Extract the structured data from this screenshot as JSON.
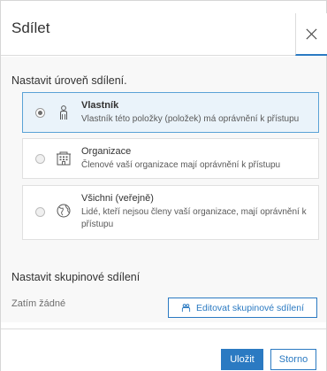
{
  "dialog": {
    "title": "Sdílet",
    "close_icon": "close-icon"
  },
  "sharing_level": {
    "heading": "Nastavit úroveň sdílení.",
    "options": [
      {
        "label": "Vlastník",
        "description": "Vlastník této položky (položek) má oprávnění k přístupu",
        "icon": "owner-icon",
        "selected": true
      },
      {
        "label": "Organizace",
        "description": "Členové vaší organizace mají oprávnění k přístupu",
        "icon": "organization-icon",
        "selected": false
      },
      {
        "label": "Všichni (veřejně)",
        "description": "Lidé, kteří nejsou členy vaší organizace, mají oprávnění k přístupu",
        "icon": "public-globe-icon",
        "selected": false
      }
    ]
  },
  "group_sharing": {
    "heading": "Nastavit skupinové sdílení",
    "none_text": "Zatím žádné",
    "edit_button": "Editovat skupinové sdílení",
    "edit_icon": "group-icon"
  },
  "footer": {
    "save_label": "Uložit",
    "cancel_label": "Storno"
  },
  "colors": {
    "accent": "#2b7ac2",
    "selected_bg": "#eaf3fa",
    "body_bg": "#f8f8f8"
  }
}
